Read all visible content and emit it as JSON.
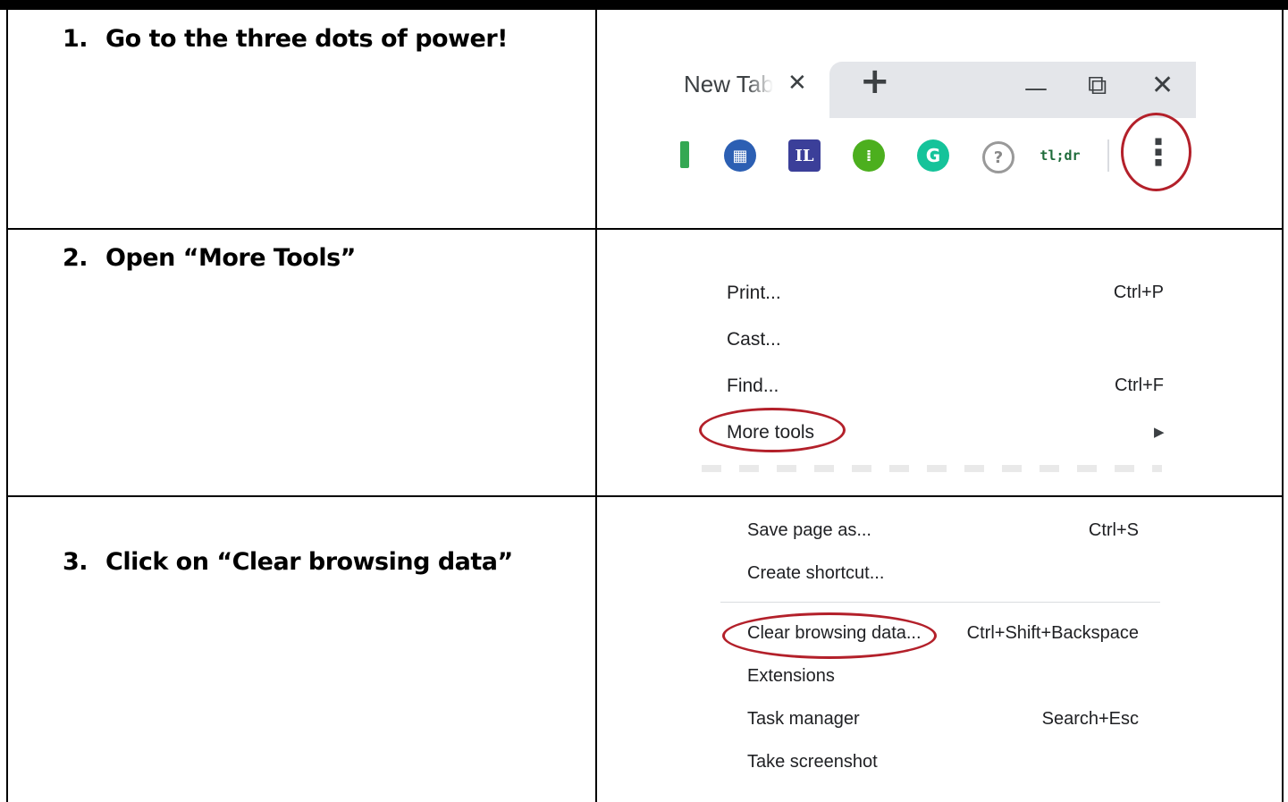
{
  "steps": [
    {
      "num": "1.",
      "text": "Go to the three dots of power!"
    },
    {
      "num": "2.",
      "text": "Open “More Tools”"
    },
    {
      "num": "3.",
      "text": "Click on “Clear browsing data”"
    }
  ],
  "browser": {
    "tab_title": "New Tab",
    "close_glyph": "✕",
    "newtab_glyph": "+",
    "minimize_glyph": "—",
    "restore_glyph": "⧉",
    "window_close_glyph": "✕",
    "menu_glyph": "⋮",
    "extensions": [
      {
        "name": "sheets-icon",
        "label": "",
        "bg": "#34a853",
        "fg": "#fff"
      },
      {
        "name": "calendar-ext-icon",
        "label": "▦",
        "bg": "#2c5fb3",
        "fg": "#fff"
      },
      {
        "name": "il-ext-icon",
        "label": "IL",
        "bg": "#3b3f99",
        "fg": "#fff"
      },
      {
        "name": "green-dots-ext-icon",
        "label": "⁞",
        "bg": "#4caf1e",
        "fg": "#fff"
      },
      {
        "name": "grammarly-ext-icon",
        "label": "G",
        "bg": "#15c39a",
        "fg": "#fff"
      },
      {
        "name": "help-ext-icon",
        "label": "?",
        "bg": "#ffffff",
        "fg": "#888"
      },
      {
        "name": "tldr-ext-icon",
        "label": "tl;dr",
        "bg": "#ffffff",
        "fg": "#1e6b3a"
      }
    ]
  },
  "menu1": [
    {
      "label": "Print...",
      "shortcut": "Ctrl+P"
    },
    {
      "label": "Cast...",
      "shortcut": ""
    },
    {
      "label": "Find...",
      "shortcut": "Ctrl+F"
    },
    {
      "label": "More tools",
      "shortcut": ""
    }
  ],
  "submenu_arrow": "▶",
  "menu2": [
    {
      "label": "Save page as...",
      "shortcut": "Ctrl+S"
    },
    {
      "label": "Create shortcut...",
      "shortcut": ""
    },
    {
      "label": "Clear browsing data...",
      "shortcut": "Ctrl+Shift+Backspace"
    },
    {
      "label": "Extensions",
      "shortcut": ""
    },
    {
      "label": "Task manager",
      "shortcut": "Search+Esc"
    },
    {
      "label": "Take screenshot",
      "shortcut": ""
    }
  ],
  "colors": {
    "highlight_ring": "#b3202a",
    "tabstrip": "#e4e6ea"
  }
}
